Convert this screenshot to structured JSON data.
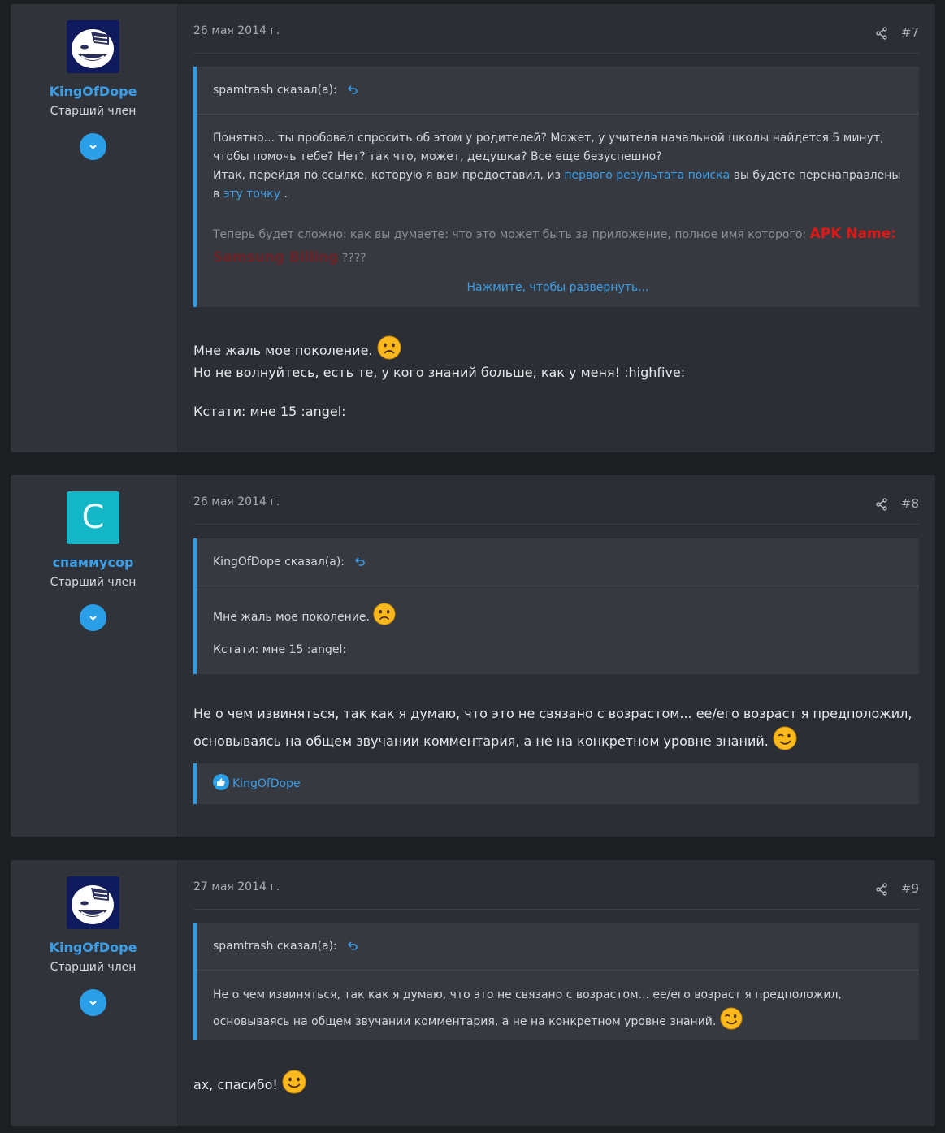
{
  "posts": [
    {
      "author": "KingOfDope",
      "title": "Старший член",
      "date": "26 мая 2014 г.",
      "num": "#7",
      "quote": {
        "author": "spamtrash сказал(а):",
        "line1": "Понятно... ты пробовал спросить об этом у родителей? Может, у учителя начальной школы найдется 5 минут, чтобы помочь тебе? Нет? так что, может, дедушка? Все еще безуспешно?",
        "line2_pre": "Итак, перейдя по ссылке, которую я вам предоставил, из ",
        "line2_link1": "первого результата поиска",
        "line2_mid": " вы будете перенаправлены в ",
        "line2_link2": "эту точку",
        "line2_end": " .",
        "line3_pre": "Теперь будет сложно: как вы думаете: что это может быть за приложение, полное имя которого: ",
        "apk_name": "APK Name:",
        "apk_value": "Samsung Billing",
        "line3_end": " ????",
        "expand": "Нажмите, чтобы развернуть..."
      },
      "message": {
        "line1": "Мне жаль мое поколение.",
        "line2": "Но не волнуйтесь, есть те, у кого знаний больше, как у меня! :highfive:",
        "line3": "Кстати: мне 15 :angel:"
      }
    },
    {
      "author": "спаммусор",
      "avatar_letter": "С",
      "title": "Старший член",
      "date": "26 мая 2014 г.",
      "num": "#8",
      "quote": {
        "author": "KingOfDope сказал(а):",
        "line1": "Мне жаль мое поколение.",
        "line2": "Кстати: мне 15 :angel:"
      },
      "message": {
        "line1": "Не о чем извиняться, так как я думаю, что это не связано с возрастом... ее/его возраст я предположил, основываясь на общем звучании комментария, а не на конкретном уровне знаний."
      },
      "likes": "KingOfDope"
    },
    {
      "author": "KingOfDope",
      "title": "Старший член",
      "date": "27 мая 2014 г.",
      "num": "#9",
      "quote": {
        "author": "spamtrash сказал(а):",
        "line1": "Не о чем извиняться, так как я думаю, что это не связано с возрастом... ее/его возраст я предположил, основываясь на общем звучании комментария, а не на конкретном уровне знаний."
      },
      "message": {
        "line1": "ах, спасибо!"
      }
    }
  ],
  "colors": {
    "accent": "#2b9ee8",
    "username": "#3c9ee6",
    "apk_red": "#e01717",
    "avatar_teal": "#13b6c6"
  },
  "icons": [
    "share-icon",
    "reply-arrow-icon",
    "chevron-down-icon",
    "thumbs-up-icon",
    "frown-emoji-icon",
    "wink-emoji-icon",
    "smile-emoji-icon"
  ]
}
